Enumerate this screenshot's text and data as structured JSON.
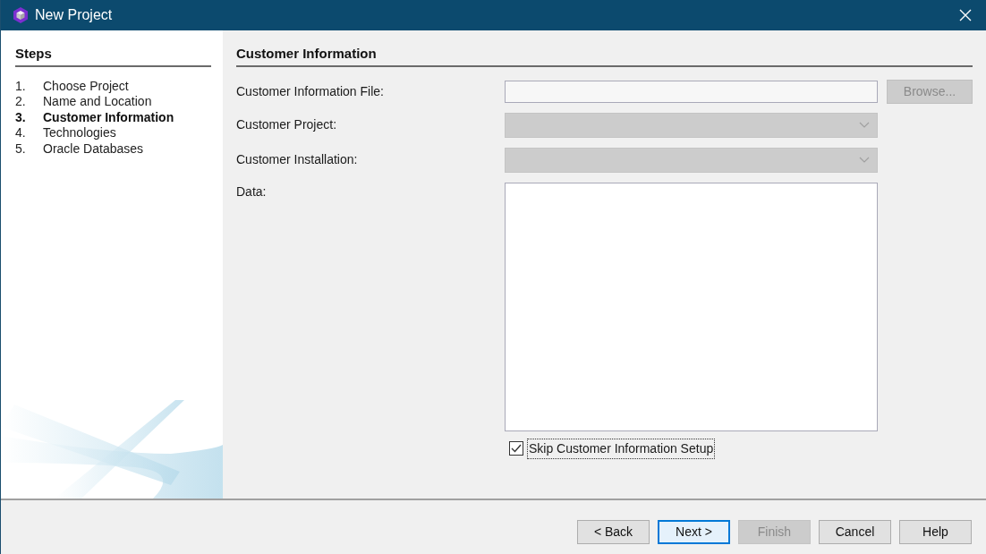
{
  "window": {
    "title": "New Project"
  },
  "steps": {
    "title": "Steps",
    "items": [
      {
        "number": "1.",
        "label": "Choose Project",
        "selected": false
      },
      {
        "number": "2.",
        "label": "Name and Location",
        "selected": false
      },
      {
        "number": "3.",
        "label": "Customer Information",
        "selected": true
      },
      {
        "number": "4.",
        "label": "Technologies",
        "selected": false
      },
      {
        "number": "5.",
        "label": "Oracle Databases",
        "selected": false
      }
    ]
  },
  "panel": {
    "title": "Customer Information",
    "fields": [
      {
        "kind": "file",
        "label": "Customer Information File:",
        "disabled": false,
        "button": "Browse...",
        "button_disabled": true
      },
      {
        "kind": "combo",
        "label": "Customer Project:",
        "disabled": true
      },
      {
        "kind": "combo",
        "label": "Customer Installation:",
        "disabled": true
      },
      {
        "kind": "textarea",
        "label": "Data:",
        "disabled": false
      }
    ],
    "checkbox": {
      "label": "Skip Customer Information Setup",
      "checked": true
    }
  },
  "buttons": [
    {
      "label": "< Back",
      "default": false,
      "disabled": false
    },
    {
      "label": "Next >",
      "default": true,
      "disabled": false
    },
    {
      "label": "Finish",
      "default": false,
      "disabled": true
    },
    {
      "label": "Cancel",
      "default": false,
      "disabled": false
    },
    {
      "label": "Help",
      "default": false,
      "disabled": false
    }
  ]
}
